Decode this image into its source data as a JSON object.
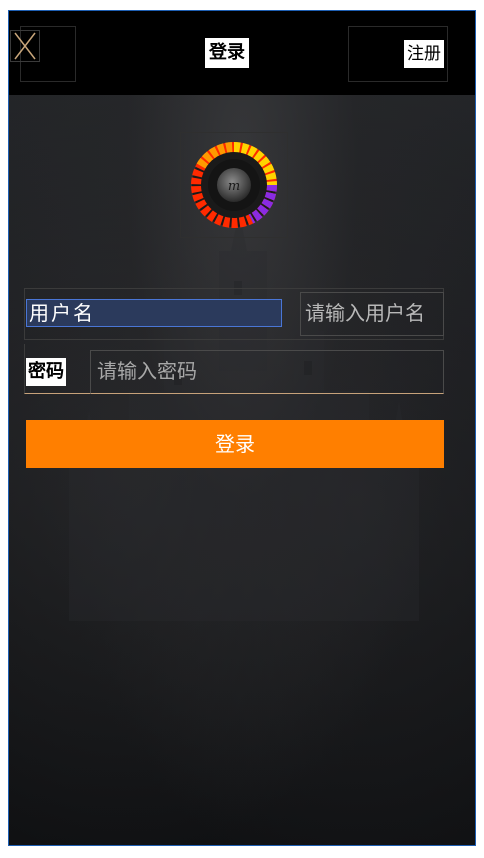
{
  "header": {
    "title": "登录",
    "register_label": "注册",
    "close_icon": "close-icon"
  },
  "logo": {
    "icon": "color-wheel-logo-icon"
  },
  "form": {
    "username_label": "用户名",
    "username_placeholder": "请输入用户名",
    "username_value": "",
    "password_label": "密码",
    "password_placeholder": "请输入密码",
    "password_value": ""
  },
  "actions": {
    "login_label": "登录"
  },
  "colors": {
    "accent": "#ff7f00",
    "topbar": "#000000",
    "selection_border": "#4a76d6"
  }
}
